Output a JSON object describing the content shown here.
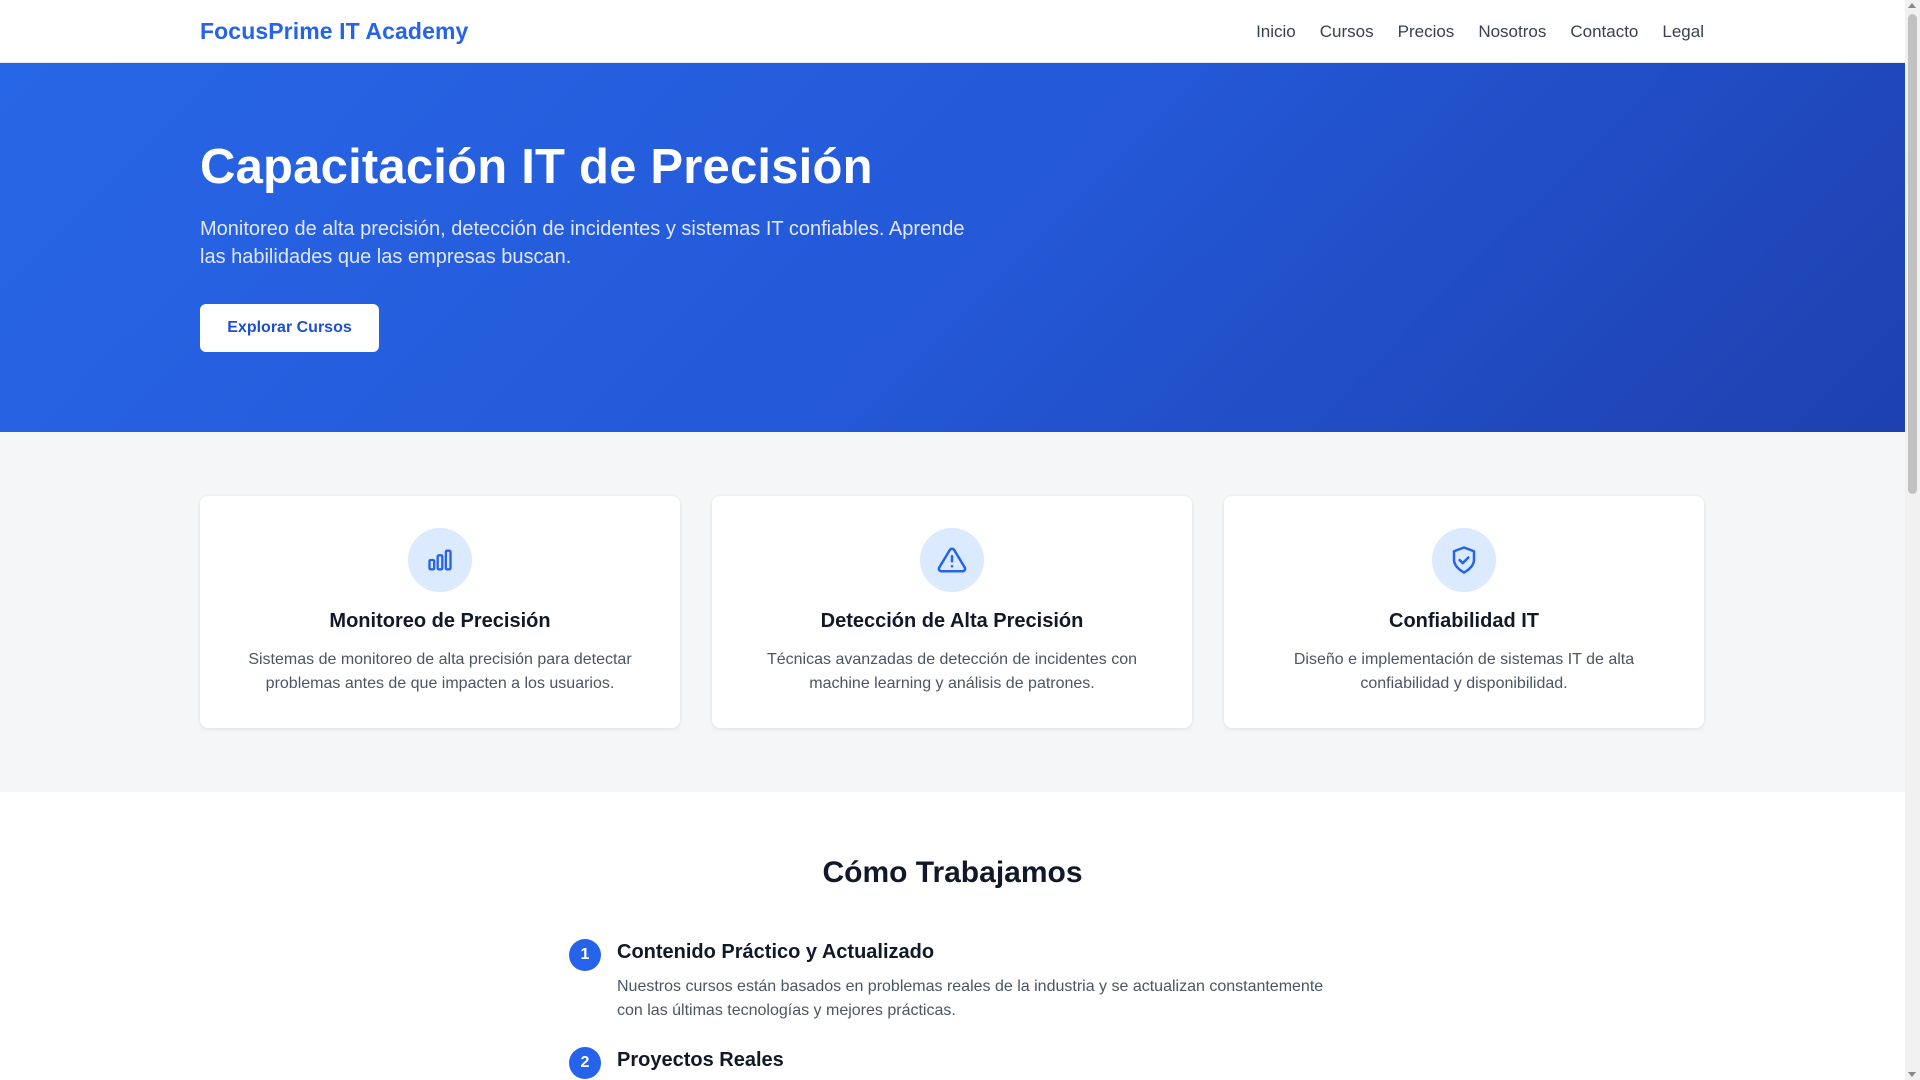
{
  "header": {
    "brand": "FocusPrime IT Academy",
    "nav": [
      "Inicio",
      "Cursos",
      "Precios",
      "Nosotros",
      "Contacto",
      "Legal"
    ]
  },
  "hero": {
    "title": "Capacitación IT de Precisión",
    "subtitle": "Monitoreo de alta precisión, detección de incidentes y sistemas IT confiables. Aprende las habilidades que las empresas buscan.",
    "cta_label": "Explorar Cursos"
  },
  "features": [
    {
      "icon": "bar-chart-icon",
      "title": "Monitoreo de Precisión",
      "text": "Sistemas de monitoreo de alta precisión para detectar problemas antes de que impacten a los usuarios."
    },
    {
      "icon": "warning-triangle-icon",
      "title": "Detección de Alta Precisión",
      "text": "Técnicas avanzadas de detección de incidentes con machine learning y análisis de patrones."
    },
    {
      "icon": "shield-check-icon",
      "title": "Confiabilidad IT",
      "text": "Diseño e implementación de sistemas IT de alta confiabilidad y disponibilidad."
    }
  ],
  "how": {
    "title": "Cómo Trabajamos",
    "steps": [
      {
        "number": "1",
        "title": "Contenido Práctico y Actualizado",
        "text": "Nuestros cursos están basados en problemas reales de la industria y se actualizan constantemente con las últimas tecnologías y mejores prácticas."
      },
      {
        "number": "2",
        "title": "Proyectos Reales",
        "text": ""
      }
    ]
  },
  "colors": {
    "accent": "#2563eb",
    "hero_start": "#2766e6",
    "hero_end": "#1e40af",
    "icon_bg": "#dbeafe"
  }
}
